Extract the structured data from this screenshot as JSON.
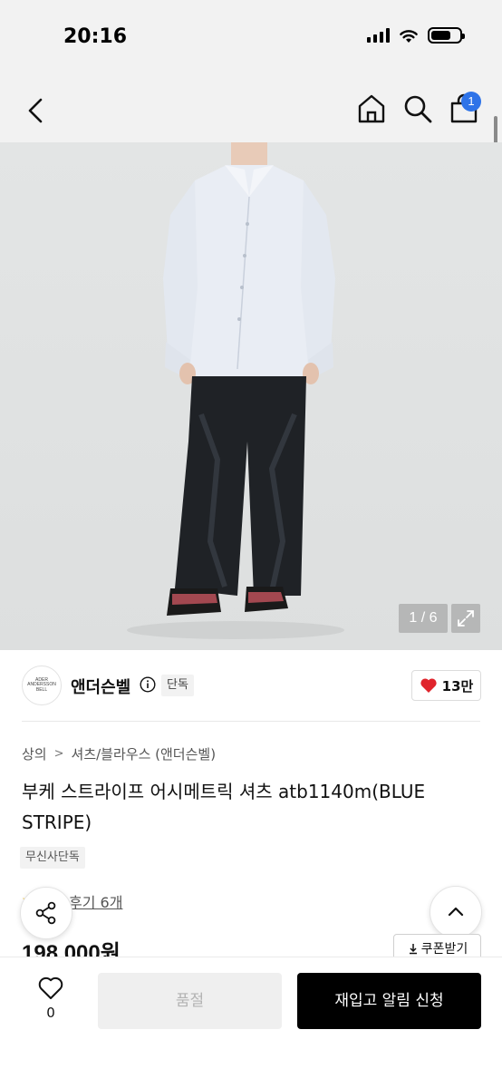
{
  "status_bar": {
    "time": "20:16"
  },
  "nav": {
    "cart_count": "1"
  },
  "image": {
    "counter": "1 / 6"
  },
  "brand": {
    "logo_text": "ADER ANDERSSON BELL",
    "name": "앤더슨벨",
    "exclusive_tag": "단독",
    "like_count": "13만"
  },
  "breadcrumb": {
    "category": "상의",
    "subcategory": "셔츠/블라우스 (앤더슨벨)"
  },
  "product": {
    "title": "부케 스트라이프 어시메트릭 셔츠 atb1140m(BLUE STRIPE)",
    "tag": "무신사단독",
    "review_link": "후기 6개",
    "price": "198,000원",
    "coupon_label": "쿠폰받기"
  },
  "bottom_bar": {
    "wish_count": "0",
    "soldout_label": "품절",
    "restock_label": "재입고 알림 신청"
  },
  "colors": {
    "accent_blue": "#2e73e8",
    "heart_red": "#e0242c",
    "primary_black": "#000000",
    "disabled_gray": "#efefef"
  },
  "icons": [
    "back-chevron-icon",
    "home-icon",
    "search-icon",
    "cart-icon",
    "expand-icon",
    "info-icon",
    "heart-icon",
    "share-icon",
    "chevron-up-icon",
    "download-icon",
    "heart-outline-icon"
  ]
}
